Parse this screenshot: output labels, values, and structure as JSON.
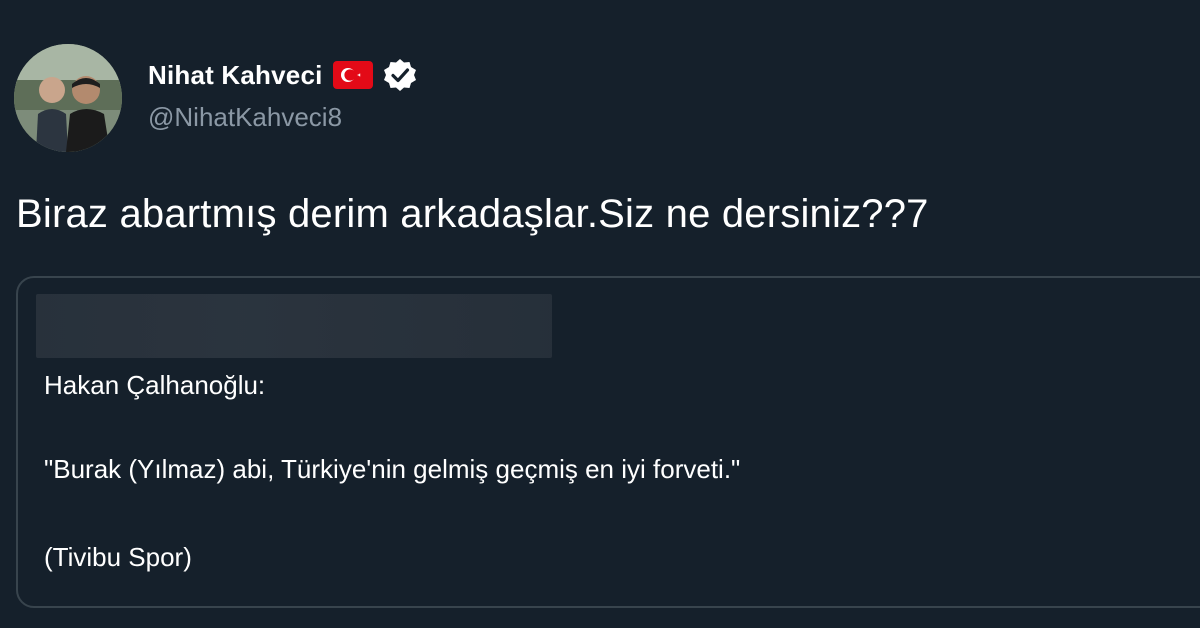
{
  "author": {
    "display_name": "Nihat Kahveci",
    "handle": "@NihatKahveci8",
    "flag_icon": "turkey-flag-icon",
    "verified_icon": "verified-badge-icon"
  },
  "tweet": {
    "text": "Biraz abartmış derim arkadaşlar.Siz ne dersiniz??7"
  },
  "quoted_tweet": {
    "lines": [
      "Hakan Çalhanoğlu:",
      "\"Burak (Yılmaz) abi, Türkiye'nin gelmiş geçmiş en iyi forveti.\"",
      "(Tivibu Spor)"
    ]
  },
  "colors": {
    "background": "#15202b",
    "text_primary": "#ffffff",
    "text_secondary": "#8b98a5",
    "border": "#38444d",
    "flag_red": "#e30a17"
  }
}
